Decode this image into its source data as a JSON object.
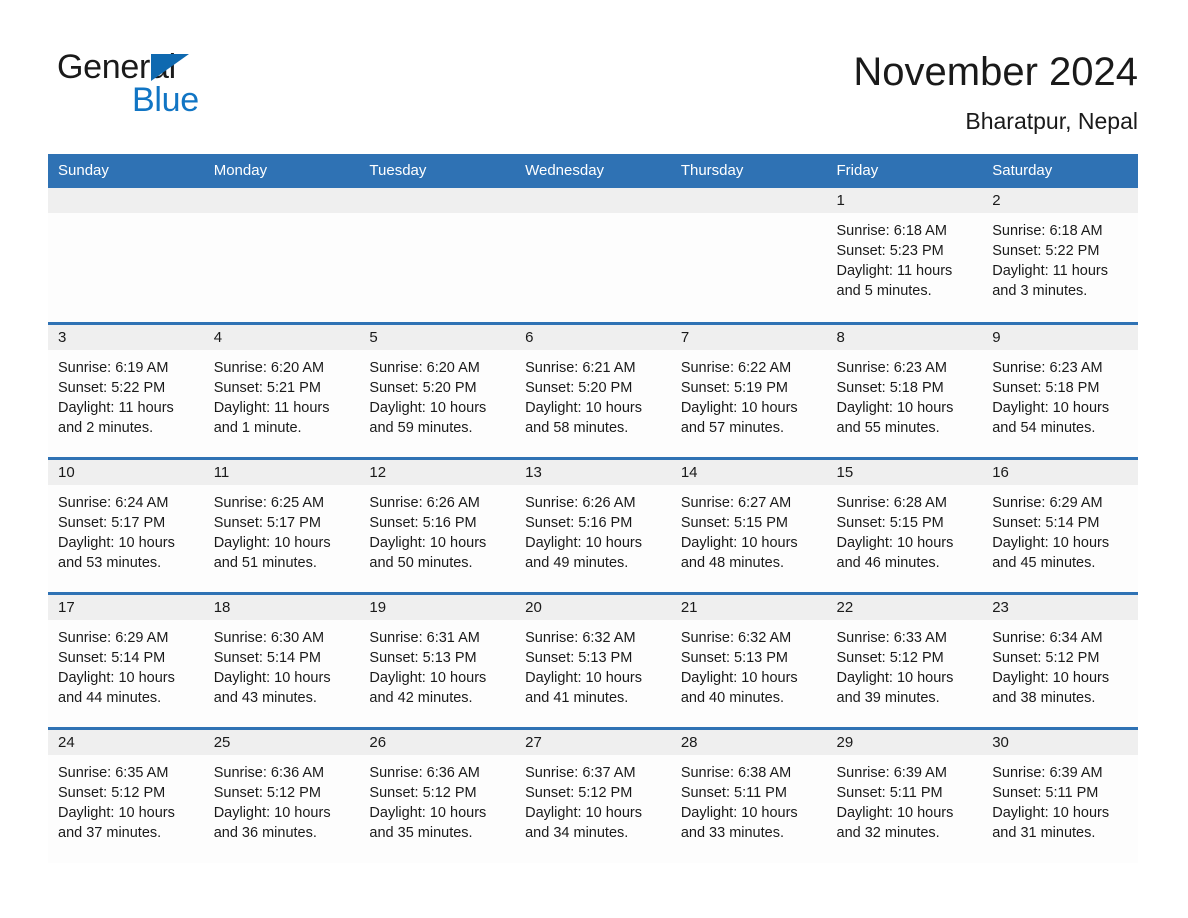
{
  "brand": {
    "word_one": "General",
    "word_two": "Blue",
    "triangle_icon": "triangle-icon",
    "accent_dark": "#0f69b0",
    "accent_blue": "#1175c4"
  },
  "header": {
    "title": "November 2024",
    "location": "Bharatpur, Nepal"
  },
  "colors": {
    "header_bar": "#2f72b4",
    "day_band": "#efefef",
    "cell_background": "#fdfdfd",
    "text": "#1a1a1a",
    "row_rule": "#2f72b4"
  },
  "calendar": {
    "weekdays": [
      "Sunday",
      "Monday",
      "Tuesday",
      "Wednesday",
      "Thursday",
      "Friday",
      "Saturday"
    ],
    "labels": {
      "sunrise": "Sunrise:",
      "sunset": "Sunset:",
      "daylight": "Daylight:"
    },
    "weeks": [
      [
        {
          "day": ""
        },
        {
          "day": ""
        },
        {
          "day": ""
        },
        {
          "day": ""
        },
        {
          "day": ""
        },
        {
          "day": "1",
          "sunrise": "Sunrise: 6:18 AM",
          "sunset": "Sunset: 5:23 PM",
          "daylight": "Daylight: 11 hours and 5 minutes."
        },
        {
          "day": "2",
          "sunrise": "Sunrise: 6:18 AM",
          "sunset": "Sunset: 5:22 PM",
          "daylight": "Daylight: 11 hours and 3 minutes."
        }
      ],
      [
        {
          "day": "3",
          "sunrise": "Sunrise: 6:19 AM",
          "sunset": "Sunset: 5:22 PM",
          "daylight": "Daylight: 11 hours and 2 minutes."
        },
        {
          "day": "4",
          "sunrise": "Sunrise: 6:20 AM",
          "sunset": "Sunset: 5:21 PM",
          "daylight": "Daylight: 11 hours and 1 minute."
        },
        {
          "day": "5",
          "sunrise": "Sunrise: 6:20 AM",
          "sunset": "Sunset: 5:20 PM",
          "daylight": "Daylight: 10 hours and 59 minutes."
        },
        {
          "day": "6",
          "sunrise": "Sunrise: 6:21 AM",
          "sunset": "Sunset: 5:20 PM",
          "daylight": "Daylight: 10 hours and 58 minutes."
        },
        {
          "day": "7",
          "sunrise": "Sunrise: 6:22 AM",
          "sunset": "Sunset: 5:19 PM",
          "daylight": "Daylight: 10 hours and 57 minutes."
        },
        {
          "day": "8",
          "sunrise": "Sunrise: 6:23 AM",
          "sunset": "Sunset: 5:18 PM",
          "daylight": "Daylight: 10 hours and 55 minutes."
        },
        {
          "day": "9",
          "sunrise": "Sunrise: 6:23 AM",
          "sunset": "Sunset: 5:18 PM",
          "daylight": "Daylight: 10 hours and 54 minutes."
        }
      ],
      [
        {
          "day": "10",
          "sunrise": "Sunrise: 6:24 AM",
          "sunset": "Sunset: 5:17 PM",
          "daylight": "Daylight: 10 hours and 53 minutes."
        },
        {
          "day": "11",
          "sunrise": "Sunrise: 6:25 AM",
          "sunset": "Sunset: 5:17 PM",
          "daylight": "Daylight: 10 hours and 51 minutes."
        },
        {
          "day": "12",
          "sunrise": "Sunrise: 6:26 AM",
          "sunset": "Sunset: 5:16 PM",
          "daylight": "Daylight: 10 hours and 50 minutes."
        },
        {
          "day": "13",
          "sunrise": "Sunrise: 6:26 AM",
          "sunset": "Sunset: 5:16 PM",
          "daylight": "Daylight: 10 hours and 49 minutes."
        },
        {
          "day": "14",
          "sunrise": "Sunrise: 6:27 AM",
          "sunset": "Sunset: 5:15 PM",
          "daylight": "Daylight: 10 hours and 48 minutes."
        },
        {
          "day": "15",
          "sunrise": "Sunrise: 6:28 AM",
          "sunset": "Sunset: 5:15 PM",
          "daylight": "Daylight: 10 hours and 46 minutes."
        },
        {
          "day": "16",
          "sunrise": "Sunrise: 6:29 AM",
          "sunset": "Sunset: 5:14 PM",
          "daylight": "Daylight: 10 hours and 45 minutes."
        }
      ],
      [
        {
          "day": "17",
          "sunrise": "Sunrise: 6:29 AM",
          "sunset": "Sunset: 5:14 PM",
          "daylight": "Daylight: 10 hours and 44 minutes."
        },
        {
          "day": "18",
          "sunrise": "Sunrise: 6:30 AM",
          "sunset": "Sunset: 5:14 PM",
          "daylight": "Daylight: 10 hours and 43 minutes."
        },
        {
          "day": "19",
          "sunrise": "Sunrise: 6:31 AM",
          "sunset": "Sunset: 5:13 PM",
          "daylight": "Daylight: 10 hours and 42 minutes."
        },
        {
          "day": "20",
          "sunrise": "Sunrise: 6:32 AM",
          "sunset": "Sunset: 5:13 PM",
          "daylight": "Daylight: 10 hours and 41 minutes."
        },
        {
          "day": "21",
          "sunrise": "Sunrise: 6:32 AM",
          "sunset": "Sunset: 5:13 PM",
          "daylight": "Daylight: 10 hours and 40 minutes."
        },
        {
          "day": "22",
          "sunrise": "Sunrise: 6:33 AM",
          "sunset": "Sunset: 5:12 PM",
          "daylight": "Daylight: 10 hours and 39 minutes."
        },
        {
          "day": "23",
          "sunrise": "Sunrise: 6:34 AM",
          "sunset": "Sunset: 5:12 PM",
          "daylight": "Daylight: 10 hours and 38 minutes."
        }
      ],
      [
        {
          "day": "24",
          "sunrise": "Sunrise: 6:35 AM",
          "sunset": "Sunset: 5:12 PM",
          "daylight": "Daylight: 10 hours and 37 minutes."
        },
        {
          "day": "25",
          "sunrise": "Sunrise: 6:36 AM",
          "sunset": "Sunset: 5:12 PM",
          "daylight": "Daylight: 10 hours and 36 minutes."
        },
        {
          "day": "26",
          "sunrise": "Sunrise: 6:36 AM",
          "sunset": "Sunset: 5:12 PM",
          "daylight": "Daylight: 10 hours and 35 minutes."
        },
        {
          "day": "27",
          "sunrise": "Sunrise: 6:37 AM",
          "sunset": "Sunset: 5:12 PM",
          "daylight": "Daylight: 10 hours and 34 minutes."
        },
        {
          "day": "28",
          "sunrise": "Sunrise: 6:38 AM",
          "sunset": "Sunset: 5:11 PM",
          "daylight": "Daylight: 10 hours and 33 minutes."
        },
        {
          "day": "29",
          "sunrise": "Sunrise: 6:39 AM",
          "sunset": "Sunset: 5:11 PM",
          "daylight": "Daylight: 10 hours and 32 minutes."
        },
        {
          "day": "30",
          "sunrise": "Sunrise: 6:39 AM",
          "sunset": "Sunset: 5:11 PM",
          "daylight": "Daylight: 10 hours and 31 minutes."
        }
      ]
    ]
  }
}
